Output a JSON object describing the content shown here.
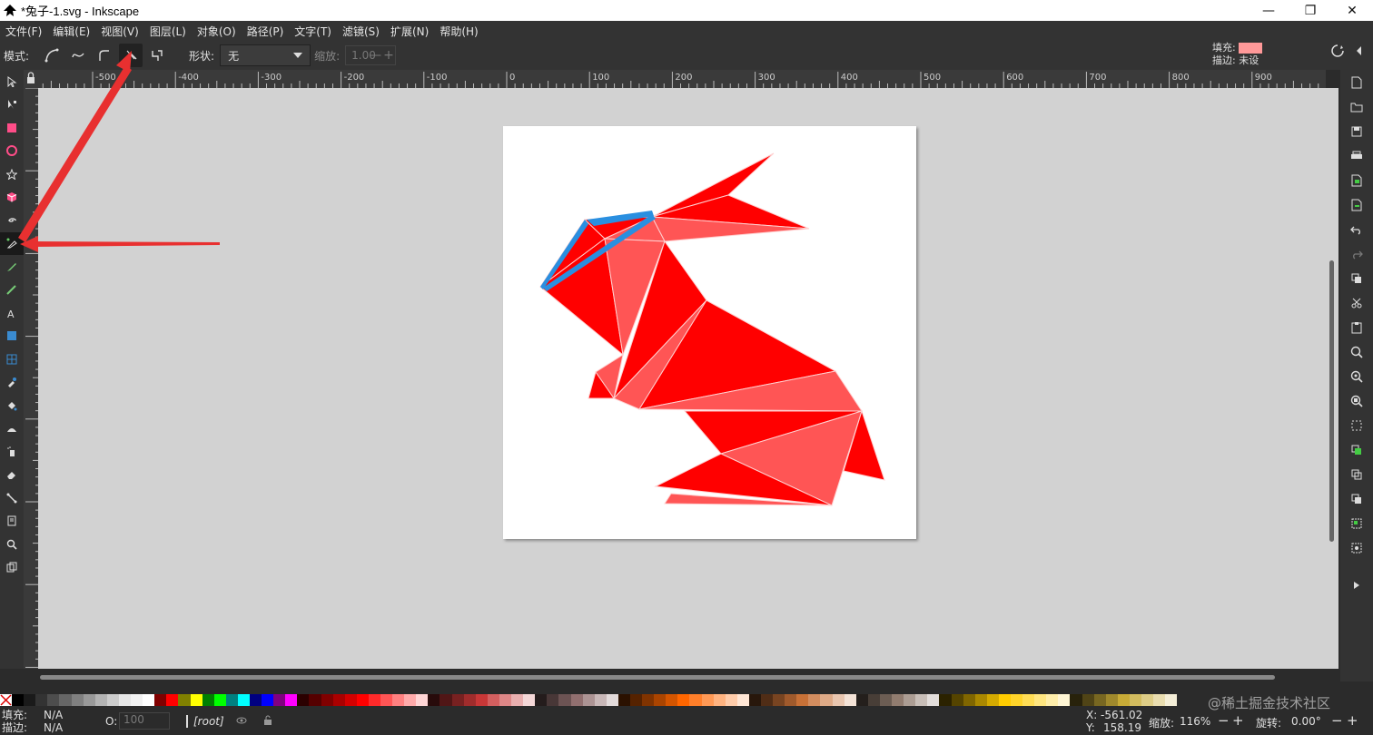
{
  "window": {
    "title": "*兔子-1.svg - Inkscape",
    "controls": {
      "minimize": "—",
      "maximize": "❐",
      "close": "✕"
    }
  },
  "menubar": {
    "items": [
      "文件(F)",
      "编辑(E)",
      "视图(V)",
      "图层(L)",
      "对象(O)",
      "路径(P)",
      "文字(T)",
      "滤镜(S)",
      "扩展(N)",
      "帮助(H)"
    ]
  },
  "tool_controls": {
    "mode_label": "模式:",
    "modes": [
      "bezier-mode-icon",
      "spiro-mode-icon",
      "bspline-mode-icon",
      "straight-segments-mode-icon",
      "paraxial-mode-icon"
    ],
    "active_mode_index": 3,
    "shape_label": "形状:",
    "shape_value": "无",
    "scale_label": "缩放:",
    "scale_value": "1.00",
    "scale_minus": "—",
    "scale_plus": "+",
    "fill_label": "填充:",
    "fill_color": "#ff9999",
    "stroke_label": "描边:",
    "stroke_value": "未设"
  },
  "ruler": {
    "top_labels": [
      "-500",
      "-400",
      "-300",
      "-200",
      "-100",
      "0",
      "100",
      "200",
      "300",
      "400",
      "500",
      "600",
      "700",
      "800",
      "900"
    ]
  },
  "toolbox": {
    "tools": [
      "selector-icon",
      "node-editor-icon",
      "rectangle-icon",
      "ellipse-icon",
      "star-icon",
      "3d-box-icon",
      "spiral-icon",
      "pen-icon",
      "pencil-icon",
      "calligraphy-icon",
      "text-icon",
      "gradient-icon",
      "mesh-icon",
      "dropper-icon",
      "paint-bucket-icon",
      "tweak-icon",
      "spray-icon",
      "eraser-icon",
      "connector-icon",
      "pages-icon",
      "zoom-icon",
      "clone-icon"
    ],
    "active_index": 7
  },
  "commands": {
    "icons": [
      "new-doc-icon",
      "open-icon",
      "save-icon",
      "print-icon",
      "import-icon",
      "export-icon",
      "undo-icon",
      "redo-icon",
      "copy-icon",
      "cut-icon",
      "paste-icon",
      "zoom-selection-icon",
      "zoom-drawing-icon",
      "zoom-page-icon",
      "zoom-width-icon",
      "duplicate-icon",
      "clone-cmd-icon",
      "unlink-clone-icon",
      "group-icon",
      "ungroup-icon"
    ]
  },
  "colors": {
    "accent_red": "#ff0000",
    "light_red": "#ff5555",
    "highlight_blue": "#2a8fe0",
    "arrow_red": "#e83030"
  },
  "palette": [
    "#000000",
    "#1a1a1a",
    "#333333",
    "#4d4d4d",
    "#666666",
    "#808080",
    "#999999",
    "#b3b3b3",
    "#cccccc",
    "#e6e6e6",
    "#f2f2f2",
    "#ffffff",
    "#800000",
    "#ff0000",
    "#808000",
    "#ffff00",
    "#008000",
    "#00ff00",
    "#008080",
    "#00ffff",
    "#000080",
    "#0000ff",
    "#800080",
    "#ff00ff",
    "#2b0000",
    "#550000",
    "#800000",
    "#aa0000",
    "#d40000",
    "#ff0000",
    "#ff2a2a",
    "#ff5555",
    "#ff8080",
    "#ffaaaa",
    "#ffd5d5",
    "#280b0b",
    "#501616",
    "#782121",
    "#a02c2c",
    "#c83737",
    "#d35f5f",
    "#de8787",
    "#e9afaf",
    "#f4d7d7",
    "#241c1c",
    "#483737",
    "#6c5353",
    "#916f6f",
    "#ac9393",
    "#c8b7b7",
    "#e3dbdb",
    "#2b1100",
    "#552200",
    "#803300",
    "#aa4400",
    "#d45500",
    "#ff6600",
    "#ff7f2a",
    "#ff9955",
    "#ffb380",
    "#ffccaa",
    "#ffe6d5",
    "#28170b",
    "#502d16",
    "#784421",
    "#a05a2c",
    "#c87137",
    "#d38d5f",
    "#deaa87",
    "#e9c6af",
    "#f4e3d7",
    "#241f1c",
    "#483e37",
    "#6c5d53",
    "#917c6f",
    "#ac9d93",
    "#c8beb7",
    "#e3dedb",
    "#2b2200",
    "#554400",
    "#806600",
    "#aa8800",
    "#d4aa00",
    "#ffcc00",
    "#ffd42a",
    "#ffdd55",
    "#ffe680",
    "#ffeeaa",
    "#fff6d5",
    "#28220b",
    "#504416",
    "#786721",
    "#a0892c",
    "#c8ab37",
    "#d3bc5f",
    "#decd87",
    "#e9ddaf",
    "#f4eed7"
  ],
  "status": {
    "fill_label": "填充:",
    "fill_value": "N/A",
    "stroke_label": "描边:",
    "stroke_value": "N/A",
    "opacity_label": "O:",
    "opacity_value": "100",
    "layer": "[root]",
    "x_label": "X:",
    "x_value": "-561.02",
    "y_label": "Y:",
    "y_value": "158.19",
    "zoom_label": "缩放:",
    "zoom_value": "116%",
    "rotate_label": "旋转:",
    "rotate_value": "0.00°"
  },
  "watermark": "@稀土掘金技术社区"
}
